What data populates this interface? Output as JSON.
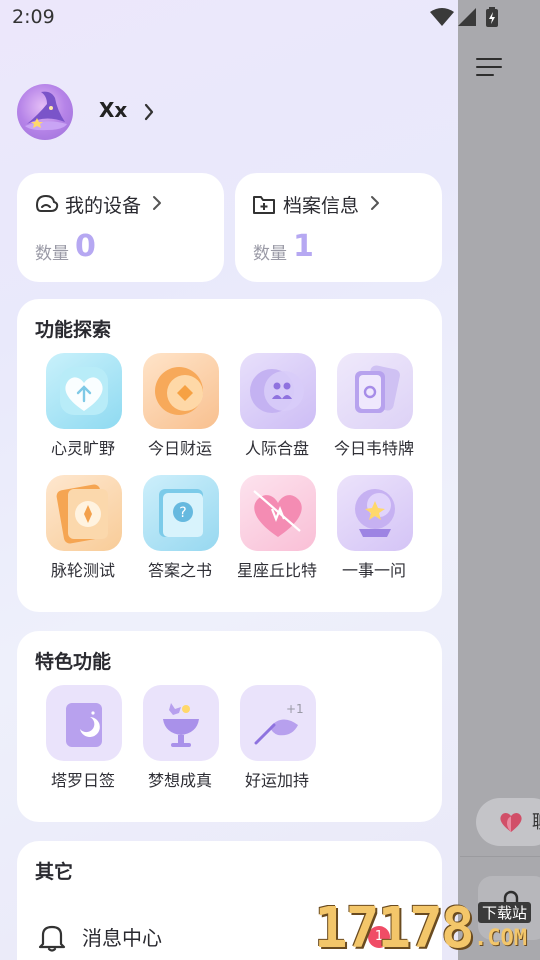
{
  "status_bar": {
    "time": "2:09",
    "icons": [
      "wifi-icon",
      "cellular-signal-icon",
      "battery-charging-icon"
    ]
  },
  "profile": {
    "name": "Xx"
  },
  "stats": {
    "devices": {
      "label": "我的设备",
      "count_label": "数量",
      "count": "0"
    },
    "archives": {
      "label": "档案信息",
      "count_label": "数量",
      "count": "1"
    }
  },
  "explore": {
    "title": "功能探索",
    "items": [
      {
        "label": "心灵旷野",
        "icon": "heart-icon"
      },
      {
        "label": "今日财运",
        "icon": "coin-icon"
      },
      {
        "label": "人际合盘",
        "icon": "people-icon"
      },
      {
        "label": "今日韦特牌",
        "icon": "tarot-cards-icon"
      },
      {
        "label": "脉轮测试",
        "icon": "chakra-icon"
      },
      {
        "label": "答案之书",
        "icon": "answer-book-icon"
      },
      {
        "label": "星座丘比特",
        "icon": "cupid-heart-icon"
      },
      {
        "label": "一事一问",
        "icon": "crystal-ball-icon"
      }
    ]
  },
  "special": {
    "title": "特色功能",
    "items": [
      {
        "label": "塔罗日签",
        "icon": "moon-card-icon"
      },
      {
        "label": "梦想成真",
        "icon": "dream-cup-icon"
      },
      {
        "label": "好运加持",
        "icon": "luck-plus-icon"
      }
    ]
  },
  "other": {
    "title": "其它",
    "items": [
      {
        "label": "消息中心",
        "icon": "bell-icon",
        "badge": "1"
      }
    ]
  },
  "background_app": {
    "chip_text": "聊",
    "icons": [
      "menu-icon",
      "heart-icon",
      "microphone-icon"
    ]
  },
  "watermark": {
    "digits": "17178",
    "suffix": ".COM",
    "tag": "下载站"
  },
  "colors": {
    "accent": "#b6a8f2",
    "badge": "#f04c66"
  }
}
